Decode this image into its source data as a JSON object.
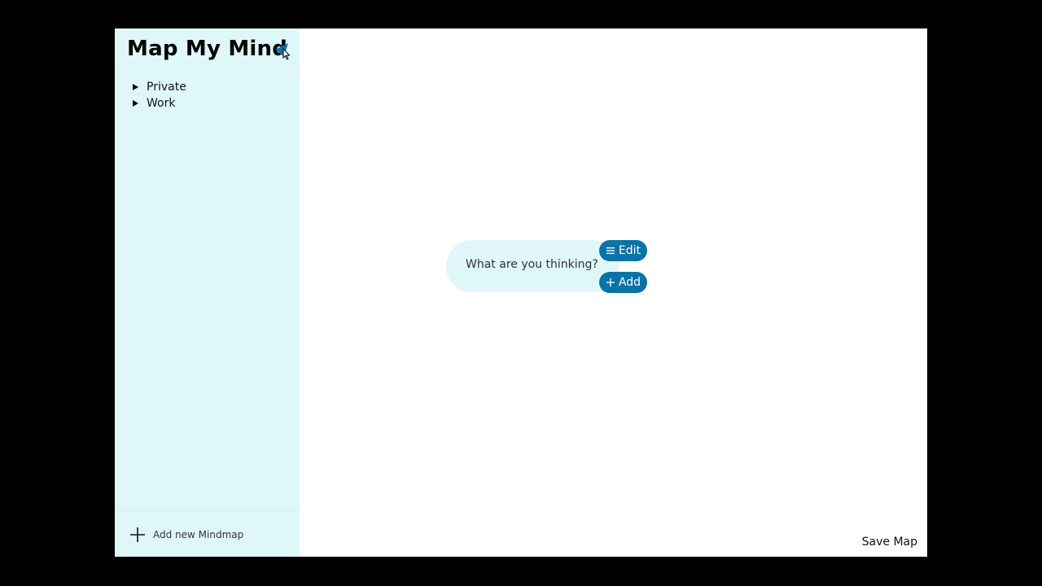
{
  "app": {
    "title": "Map My Mind"
  },
  "sidebar": {
    "items": [
      {
        "label": "Private"
      },
      {
        "label": "Work"
      }
    ],
    "add_label": "Add new Mindmap"
  },
  "canvas": {
    "node_text": "What are you thinking?",
    "edit_label": "Edit",
    "add_label": "Add",
    "save_label": "Save Map"
  },
  "colors": {
    "sidebar_bg": "#e0f7fa",
    "accent": "#0a73a8",
    "page_bg": "#000000"
  },
  "icons": {
    "collapse": "triangle-left-icon",
    "tree_arrow": "triangle-right-icon",
    "add": "plus-icon",
    "edit": "menu-lines-icon",
    "node_add": "plus-icon"
  }
}
